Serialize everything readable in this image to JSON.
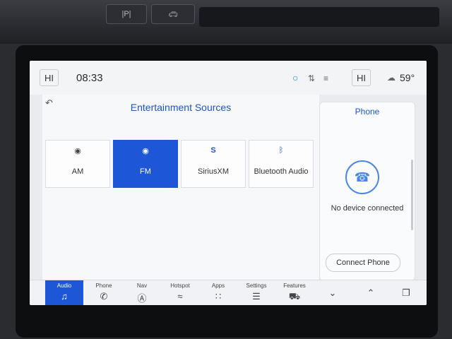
{
  "hardware": {
    "park_label": "|P|",
    "car_icon": "car-icon"
  },
  "status": {
    "hi_left": "HI",
    "time": "08:33",
    "hi_right": "HI",
    "temperature": "59°"
  },
  "entertainment": {
    "title": "Entertainment Sources",
    "sources": [
      {
        "label": "AM",
        "icon": "antenna-icon",
        "selected": false
      },
      {
        "label": "FM",
        "icon": "antenna-waves-icon",
        "selected": true
      },
      {
        "label": "SiriusXM",
        "icon": "siriusxm-icon",
        "selected": false
      },
      {
        "label": "Bluetooth Audio",
        "icon": "bluetooth-icon",
        "selected": false
      }
    ]
  },
  "phone": {
    "title": "Phone",
    "message": "No device connected",
    "connect_label": "Connect Phone"
  },
  "nav": {
    "items": [
      {
        "label": "Audio",
        "icon": "music-note-icon",
        "active": true
      },
      {
        "label": "Phone",
        "icon": "phone-icon"
      },
      {
        "label": "Nav",
        "icon": "navigation-icon"
      },
      {
        "label": "Hotspot",
        "icon": "car-wifi-icon"
      },
      {
        "label": "Apps",
        "icon": "apps-grid-icon"
      },
      {
        "label": "Settings",
        "icon": "sliders-icon"
      },
      {
        "label": "Features",
        "icon": "car-features-icon"
      }
    ]
  },
  "colors": {
    "accent": "#1d56d6",
    "title_blue": "#1a56c7",
    "screen_bg": "#e9ebef"
  }
}
